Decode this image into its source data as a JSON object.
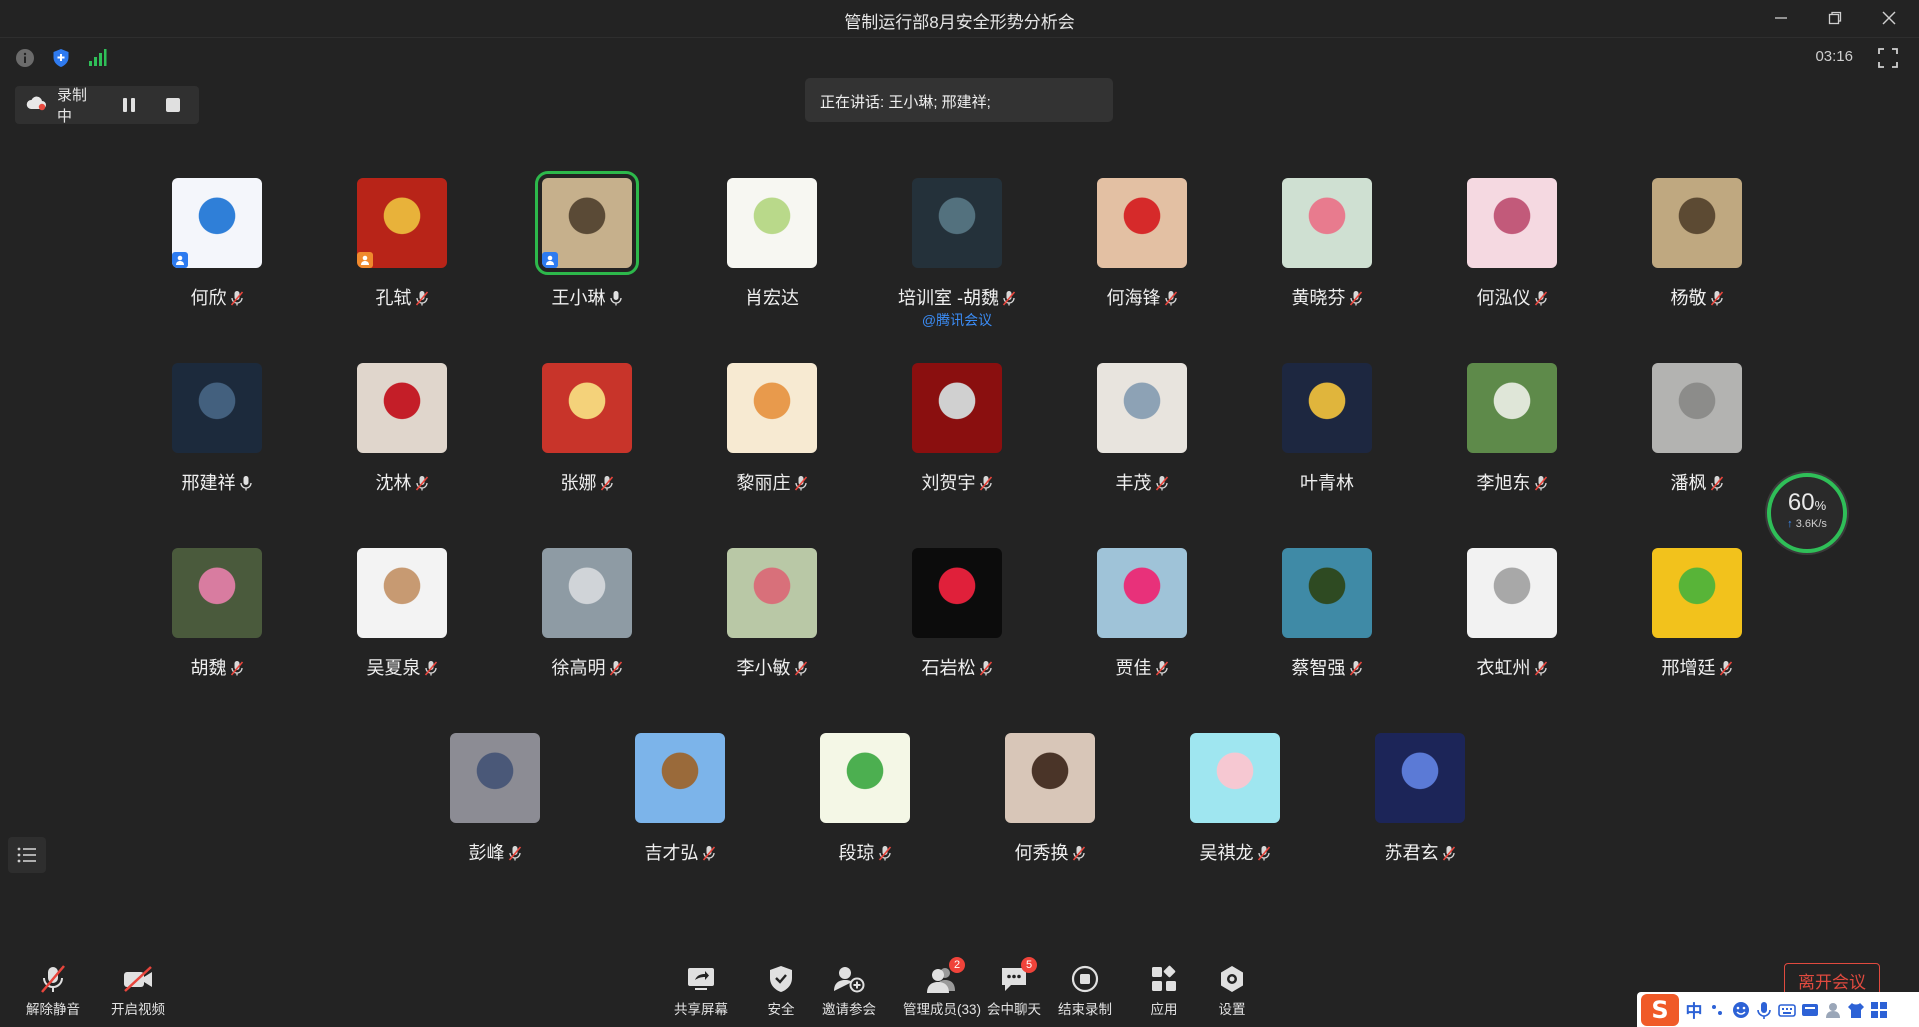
{
  "window": {
    "title": "管制运行部8月安全形势分析会"
  },
  "topbar": {
    "timer": "03:16"
  },
  "recording": {
    "label": "录制中"
  },
  "speaking": {
    "text": "正在讲话: 王小琳; 邢建祥;"
  },
  "network": {
    "percent": "60",
    "percent_unit": "%",
    "speed": "3.6K/s"
  },
  "participants": [
    {
      "name": "何欣",
      "mic": "muted",
      "badge": "blue",
      "color": "#f4f6fb",
      "accent": "#2f7fd8"
    },
    {
      "name": "孔轼",
      "mic": "muted",
      "badge": "orange",
      "color": "#b82418",
      "accent": "#e8b23a"
    },
    {
      "name": "王小琳",
      "mic": "on",
      "badge": "blue",
      "active": true,
      "color": "#c6b08c",
      "accent": "#5a4a36"
    },
    {
      "name": "肖宏达",
      "mic": "none",
      "color": "#f7f7f2",
      "accent": "#b9d98a"
    },
    {
      "name": "培训室 -胡魏",
      "mic": "muted",
      "sub": "@腾讯会议",
      "color": "#24313a",
      "accent": "#53717e"
    },
    {
      "name": "何海锋",
      "mic": "muted",
      "color": "#e3c0a3",
      "accent": "#d62a2a"
    },
    {
      "name": "黄晓芬",
      "mic": "muted",
      "color": "#cfe0d2",
      "accent": "#e87b8e"
    },
    {
      "name": "何泓仪",
      "mic": "muted",
      "color": "#f5d9e1",
      "accent": "#c25a7a"
    },
    {
      "name": "杨敬",
      "mic": "muted",
      "color": "#bfa880",
      "accent": "#5c4a33"
    },
    {
      "name": "邢建祥",
      "mic": "on",
      "color": "#1c2a3c",
      "accent": "#43607e"
    },
    {
      "name": "沈林",
      "mic": "muted",
      "color": "#e0d6cc",
      "accent": "#c41e28"
    },
    {
      "name": "张娜",
      "mic": "muted",
      "color": "#c8342a",
      "accent": "#f4d27a"
    },
    {
      "name": "黎丽庄",
      "mic": "muted",
      "color": "#f7ead2",
      "accent": "#e89a4c"
    },
    {
      "name": "刘贺宇",
      "mic": "muted",
      "color": "#8a0f0f",
      "accent": "#d0d0d0"
    },
    {
      "name": "丰茂",
      "mic": "muted",
      "color": "#e8e4de",
      "accent": "#8da2b5"
    },
    {
      "name": "叶青林",
      "mic": "none",
      "color": "#1d2740",
      "accent": "#e0b53c"
    },
    {
      "name": "李旭东",
      "mic": "muted",
      "color": "#5e8a4a",
      "accent": "#dfe6d8"
    },
    {
      "name": "潘枫",
      "mic": "muted",
      "color": "#b3b3b1",
      "accent": "#8c8c8a"
    },
    {
      "name": "胡魏",
      "mic": "muted",
      "color": "#4a5a3c",
      "accent": "#d87ca0"
    },
    {
      "name": "吴夏泉",
      "mic": "muted",
      "color": "#f3f3f3",
      "accent": "#c79a72"
    },
    {
      "name": "徐高明",
      "mic": "muted",
      "color": "#8e9ba4",
      "accent": "#d0d4d8"
    },
    {
      "name": "李小敏",
      "mic": "muted",
      "color": "#b9c8a6",
      "accent": "#d8707a"
    },
    {
      "name": "石岩松",
      "mic": "muted",
      "color": "#0c0c0c",
      "accent": "#e0203a"
    },
    {
      "name": "贾佳",
      "mic": "muted",
      "color": "#9fc3d8",
      "accent": "#e8317a"
    },
    {
      "name": "蔡智强",
      "mic": "muted",
      "color": "#3f8aa6",
      "accent": "#2e4a22"
    },
    {
      "name": "衣虹州",
      "mic": "muted",
      "color": "#f2f2f2",
      "accent": "#a8a8a8"
    },
    {
      "name": "邢增廷",
      "mic": "muted",
      "color": "#f2c21c",
      "accent": "#58b438"
    },
    {
      "name": "彭峰",
      "mic": "muted",
      "color": "#8c8c94",
      "accent": "#4a5878"
    },
    {
      "name": "吉才弘",
      "mic": "muted",
      "color": "#7cb4ea",
      "accent": "#9a6a3a"
    },
    {
      "name": "段琼",
      "mic": "muted",
      "color": "#f4f7e6",
      "accent": "#4caf50"
    },
    {
      "name": "何秀换",
      "mic": "muted",
      "color": "#d8c6b8",
      "accent": "#4a3428"
    },
    {
      "name": "吴祺龙",
      "mic": "muted",
      "color": "#9fe6f0",
      "accent": "#f6c8d2"
    },
    {
      "name": "苏君玄",
      "mic": "muted",
      "color": "#1c2558",
      "accent": "#5b7ad6"
    }
  ],
  "toolbar": {
    "unmute": "解除静音",
    "video": "开启视频",
    "share": "共享屏幕",
    "security": "安全",
    "invite": "邀请参会",
    "members": "管理成员(33)",
    "members_badge": "2",
    "chat": "会中聊天",
    "chat_badge": "5",
    "end_record": "结束录制",
    "apps": "应用",
    "settings": "设置",
    "leave": "离开会议"
  },
  "ime": {
    "logo": "S",
    "lang": "中"
  }
}
